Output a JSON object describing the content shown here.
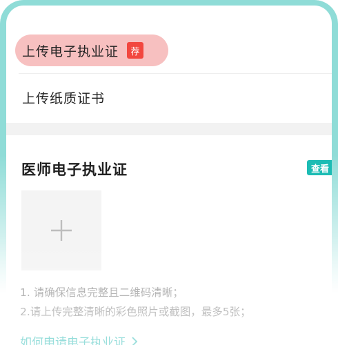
{
  "upload_options": {
    "electronic": {
      "label": "上传电子执业证",
      "badge": "荐"
    },
    "paper": {
      "label": "上传纸质证书"
    }
  },
  "card": {
    "title": "医师电子执业证",
    "view_tag": "查看",
    "upload_icon": "plus-icon",
    "tips": [
      "1. 请确保信息完整且二维码清晰；",
      "2.请上传完整清晰的彩色照片或截图，最多5张；"
    ],
    "apply_link": "如何申请电子执业证"
  },
  "colors": {
    "accent": "#1cbcb4",
    "link": "#25b9b3",
    "highlight": "#f7c0c0",
    "badge": "#f2473f",
    "frame": "#8fdcd7"
  }
}
